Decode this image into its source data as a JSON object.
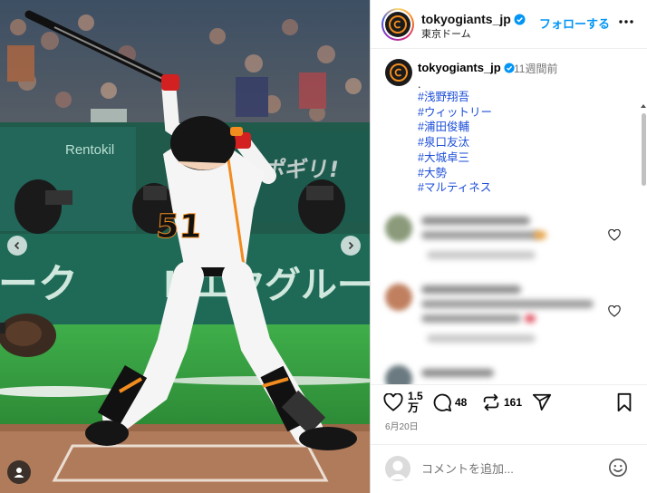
{
  "post": {
    "username": "tokyogiants_jp",
    "location": "東京ドーム",
    "follow_label": "フォローする",
    "more_label": "…"
  },
  "caption": {
    "username": "tokyogiants_jp",
    "time_ago": "11週間前",
    "first_line": ".",
    "hashtags": [
      "#浅野翔吾",
      "#ウィットリー",
      "#浦田俊輔",
      "#泉口友汰",
      "#大城卓三",
      "#大勢",
      "#マルティネス"
    ]
  },
  "photo": {
    "jersey_number": "51",
    "banner_texts": [
      "Rentokil",
      "スポギリ!",
      "エクグルー"
    ]
  },
  "actions": {
    "likes": "1.5\n万",
    "likes_top": "1.5",
    "likes_bottom": "万",
    "comments": "48",
    "reposts": "161",
    "date": "6月20日"
  },
  "comment_box": {
    "placeholder": "コメントを追加..."
  },
  "icons": {
    "like": "heart-icon",
    "comment": "comment-icon",
    "repost": "repost-icon",
    "share": "paper-plane-icon",
    "save": "bookmark-icon",
    "emoji": "smiley-icon",
    "verified": "verified-badge-icon",
    "more": "more-options-icon"
  },
  "colors": {
    "accent": "#0095f6",
    "verified": "#0095f6",
    "hashtag": "#1d4ed8",
    "muted": "#737373",
    "field_green": "#2f8f3a",
    "giants_orange": "#f28c1f"
  }
}
